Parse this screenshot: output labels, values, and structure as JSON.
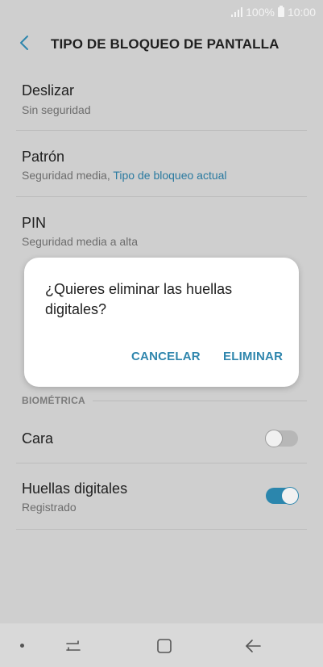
{
  "status": {
    "signal_icon": "signal-icon",
    "battery_percent": "100%",
    "time": "10:00"
  },
  "header": {
    "title": "TIPO DE BLOQUEO DE PANTALLA"
  },
  "options": [
    {
      "title": "Deslizar",
      "subtitle": "Sin seguridad"
    },
    {
      "title": "Patrón",
      "subtitle_prefix": "Seguridad media, ",
      "subtitle_accent": "Tipo de bloqueo actual"
    },
    {
      "title": "PIN",
      "subtitle": "Seguridad media a alta"
    }
  ],
  "section": {
    "label": "BIOMÉTRICA"
  },
  "biometrics": [
    {
      "title": "Cara",
      "toggle": "off"
    },
    {
      "title": "Huellas digitales",
      "subtitle": "Registrado",
      "toggle": "on"
    }
  ],
  "dialog": {
    "message": "¿Quieres eliminar las huellas digitales?",
    "cancel": "CANCELAR",
    "confirm": "ELIMINAR"
  },
  "colors": {
    "accent": "#2f86ad",
    "overlay_bg": "#cfcfcf"
  }
}
